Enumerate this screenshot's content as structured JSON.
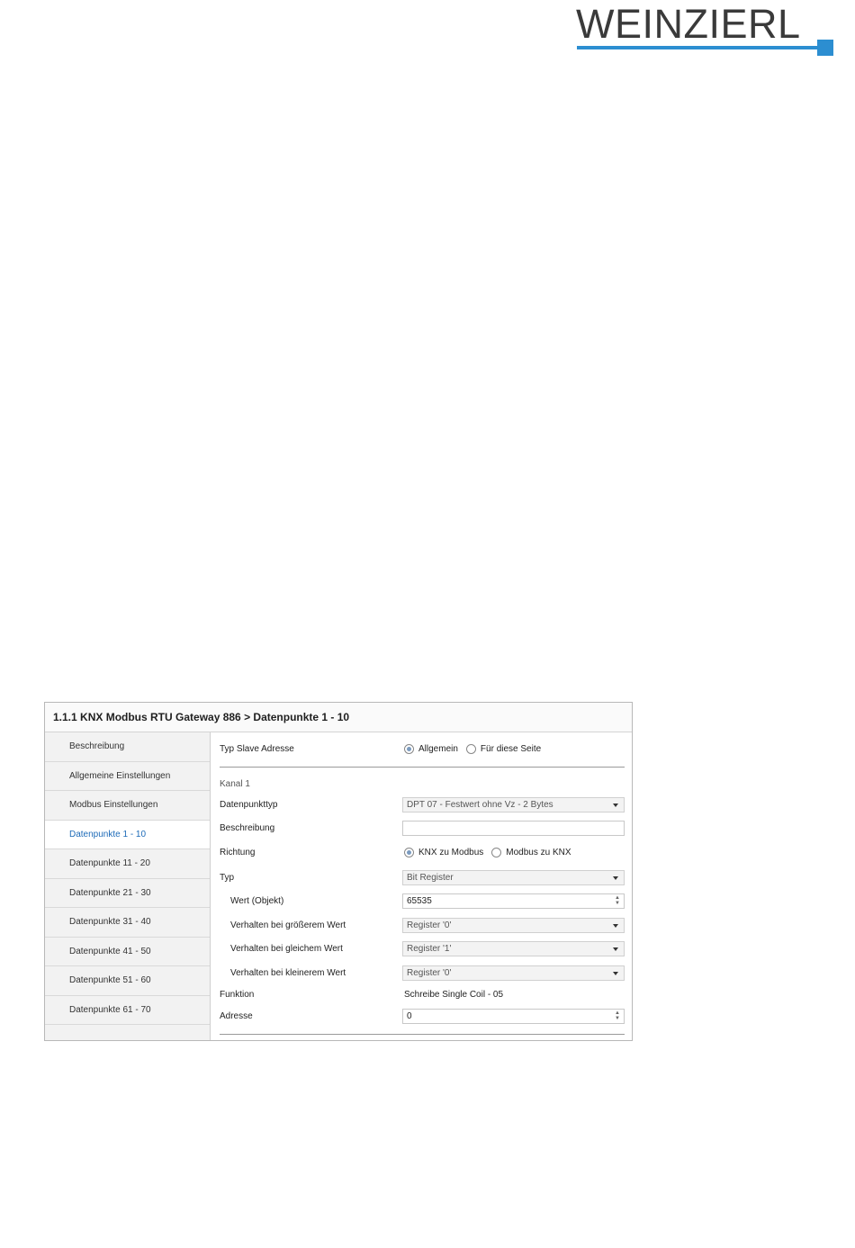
{
  "logo": {
    "text": "WEINZIERL",
    "accent_color": "#2c8ed1"
  },
  "window": {
    "title": "1.1.1 KNX Modbus RTU Gateway 886 > Datenpunkte 1 - 10",
    "sidebar": {
      "items": [
        {
          "label": "Beschreibung"
        },
        {
          "label": "Allgemeine Einstellungen"
        },
        {
          "label": "Modbus Einstellungen"
        },
        {
          "label": "Datenpunkte 1 - 10",
          "active": true
        },
        {
          "label": "Datenpunkte 11 - 20"
        },
        {
          "label": "Datenpunkte 21 - 30"
        },
        {
          "label": "Datenpunkte 31 - 40"
        },
        {
          "label": "Datenpunkte 41 - 50"
        },
        {
          "label": "Datenpunkte 51 - 60"
        },
        {
          "label": "Datenpunkte 61 - 70"
        }
      ]
    },
    "form": {
      "typ_slave_adresse": {
        "label": "Typ Slave Adresse",
        "options": [
          "Allgemein",
          "Für diese Seite"
        ],
        "selected": "Allgemein"
      },
      "section_title": "Kanal 1",
      "datenpunkttyp": {
        "label": "Datenpunkttyp",
        "value": "DPT 07 - Festwert ohne Vz - 2 Bytes"
      },
      "beschreibung": {
        "label": "Beschreibung",
        "value": ""
      },
      "richtung": {
        "label": "Richtung",
        "options": [
          "KNX zu Modbus",
          "Modbus zu KNX"
        ],
        "selected": "KNX zu Modbus"
      },
      "typ": {
        "label": "Typ",
        "value": "Bit Register"
      },
      "wert_objekt": {
        "label": "Wert (Objekt)",
        "value": "65535"
      },
      "verhalten_groesser": {
        "label": "Verhalten bei größerem Wert",
        "value": "Register '0'"
      },
      "verhalten_gleich": {
        "label": "Verhalten bei gleichem Wert",
        "value": "Register '1'"
      },
      "verhalten_kleiner": {
        "label": "Verhalten bei kleinerem Wert",
        "value": "Register '0'"
      },
      "funktion": {
        "label": "Funktion",
        "value": "Schreibe Single Coil - 05"
      },
      "adresse": {
        "label": "Adresse",
        "value": "0"
      }
    }
  }
}
